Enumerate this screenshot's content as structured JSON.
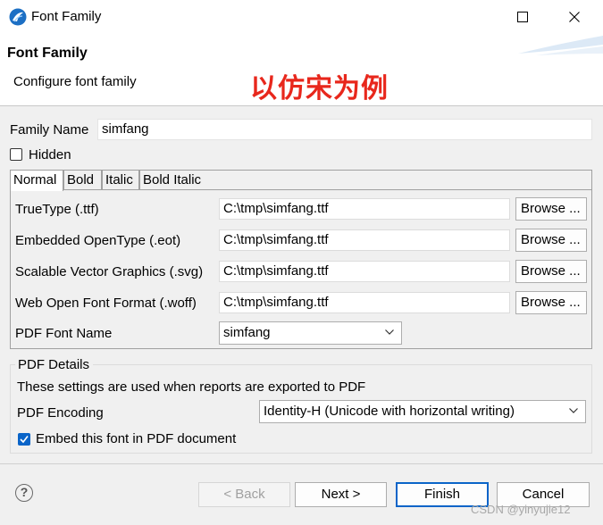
{
  "window": {
    "title": "Font Family"
  },
  "header": {
    "title": "Font Family",
    "description": "Configure font family",
    "annotation": "以仿宋为例"
  },
  "family_name": {
    "label": "Family Name",
    "value": "simfang"
  },
  "hidden": {
    "label": "Hidden",
    "checked": false
  },
  "tabs": [
    {
      "label": "Normal",
      "active": true
    },
    {
      "label": "Bold",
      "active": false
    },
    {
      "label": "Italic",
      "active": false
    },
    {
      "label": "Bold Italic",
      "active": false
    }
  ],
  "fonts": {
    "ttf": {
      "label": "TrueType (.ttf)",
      "value": "C:\\tmp\\simfang.ttf",
      "button": "Browse ..."
    },
    "eot": {
      "label": "Embedded OpenType (.eot)",
      "value": "C:\\tmp\\simfang.ttf",
      "button": "Browse ..."
    },
    "svg": {
      "label": "Scalable Vector Graphics (.svg)",
      "value": "C:\\tmp\\simfang.ttf",
      "button": "Browse ..."
    },
    "woff": {
      "label": "Web Open Font Format (.woff)",
      "value": "C:\\tmp\\simfang.ttf",
      "button": "Browse ..."
    }
  },
  "pdf_font_name": {
    "label": "PDF Font Name",
    "value": "simfang"
  },
  "pdf_details": {
    "title": "PDF Details",
    "description": "These settings are used when reports are exported to PDF",
    "encoding_label": "PDF Encoding",
    "encoding_value": "Identity-H (Unicode with horizontal writing)",
    "embed_label": "Embed this font in PDF document",
    "embed_checked": true
  },
  "footer": {
    "help": "?",
    "back": "< Back",
    "next": "Next >",
    "finish": "Finish",
    "cancel": "Cancel"
  },
  "watermark": "CSDN @yinyujie12",
  "colors": {
    "annotation": "#e8271c",
    "accent": "#0a64c8"
  }
}
